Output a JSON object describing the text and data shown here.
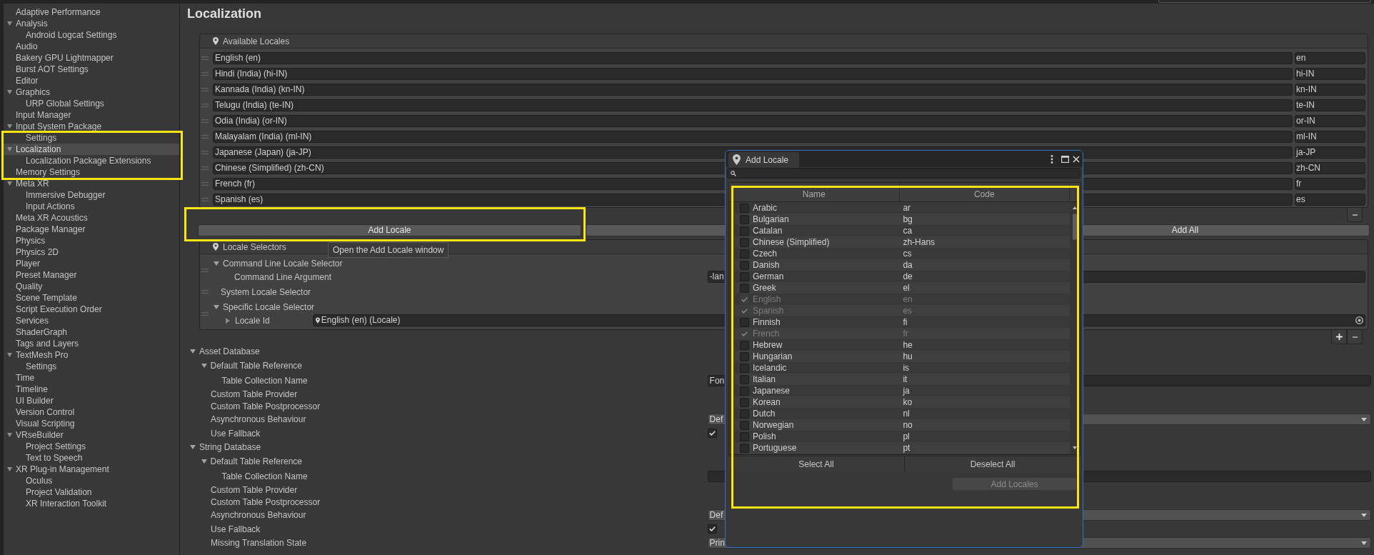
{
  "sidebar": {
    "items": [
      {
        "label": "Adaptive Performance",
        "selected": false
      },
      {
        "label": "Analysis",
        "selected": false,
        "expanded": true,
        "children": [
          {
            "label": "Android Logcat Settings",
            "selected": false
          }
        ]
      },
      {
        "label": "Audio",
        "selected": false
      },
      {
        "label": "Bakery GPU Lightmapper",
        "selected": false
      },
      {
        "label": "Burst AOT Settings",
        "selected": false
      },
      {
        "label": "Editor",
        "selected": false
      },
      {
        "label": "Graphics",
        "selected": false,
        "expanded": true,
        "children": [
          {
            "label": "URP Global Settings",
            "selected": false
          }
        ]
      },
      {
        "label": "Input Manager",
        "selected": false
      },
      {
        "label": "Input System Package",
        "selected": false,
        "expanded": true,
        "children": [
          {
            "label": "Settings",
            "selected": false
          }
        ]
      },
      {
        "label": "Localization",
        "selected": true,
        "expanded": true,
        "children": [
          {
            "label": "Localization Package Extensions",
            "selected": false
          }
        ]
      },
      {
        "label": "Memory Settings",
        "selected": false
      },
      {
        "label": "Meta XR",
        "selected": false,
        "expanded": true,
        "children": [
          {
            "label": "Immersive Debugger",
            "selected": false
          },
          {
            "label": "Input Actions",
            "selected": false
          }
        ]
      },
      {
        "label": "Meta XR Acoustics",
        "selected": false
      },
      {
        "label": "Package Manager",
        "selected": false
      },
      {
        "label": "Physics",
        "selected": false
      },
      {
        "label": "Physics 2D",
        "selected": false
      },
      {
        "label": "Player",
        "selected": false
      },
      {
        "label": "Preset Manager",
        "selected": false
      },
      {
        "label": "Quality",
        "selected": false
      },
      {
        "label": "Scene Template",
        "selected": false
      },
      {
        "label": "Script Execution Order",
        "selected": false
      },
      {
        "label": "Services",
        "selected": false
      },
      {
        "label": "ShaderGraph",
        "selected": false
      },
      {
        "label": "Tags and Layers",
        "selected": false
      },
      {
        "label": "TextMesh Pro",
        "selected": false,
        "expanded": true,
        "children": [
          {
            "label": "Settings",
            "selected": false
          }
        ]
      },
      {
        "label": "Time",
        "selected": false
      },
      {
        "label": "Timeline",
        "selected": false
      },
      {
        "label": "UI Builder",
        "selected": false
      },
      {
        "label": "Version Control",
        "selected": false
      },
      {
        "label": "Visual Scripting",
        "selected": false
      },
      {
        "label": "VRseBuilder",
        "selected": false,
        "expanded": true,
        "children": [
          {
            "label": "Project Settings",
            "selected": false
          },
          {
            "label": "Text to Speech",
            "selected": false
          }
        ]
      },
      {
        "label": "XR Plug-in Management",
        "selected": false,
        "expanded": true,
        "children": [
          {
            "label": "Oculus",
            "selected": false
          },
          {
            "label": "Project Validation",
            "selected": false
          },
          {
            "label": "XR Interaction Toolkit",
            "selected": false
          }
        ]
      }
    ]
  },
  "page": {
    "title": "Localization"
  },
  "available_locales": {
    "title": "Available Locales",
    "rows": [
      {
        "name": "English (en)",
        "code": "en"
      },
      {
        "name": "Hindi (India) (hi-IN)",
        "code": "hi-IN"
      },
      {
        "name": "Kannada (India) (kn-IN)",
        "code": "kn-IN"
      },
      {
        "name": "Telugu (India) (te-IN)",
        "code": "te-IN"
      },
      {
        "name": "Odia (India) (or-IN)",
        "code": "or-IN"
      },
      {
        "name": "Malayalam (India) (ml-IN)",
        "code": "ml-IN"
      },
      {
        "name": "Japanese (Japan) (ja-JP)",
        "code": "ja-JP"
      },
      {
        "name": "Chinese (Simplified) (zh-CN)",
        "code": "zh-CN"
      },
      {
        "name": "French (fr)",
        "code": "fr"
      },
      {
        "name": "Spanish (es)",
        "code": "es"
      }
    ]
  },
  "locale_buttons": [
    {
      "kind": "button",
      "label": "Add Locale"
    },
    {
      "kind": "blank"
    },
    {
      "kind": "button",
      "label": "Add All"
    }
  ],
  "tooltip": {
    "text": "Open the Add Locale window"
  },
  "locale_selectors": {
    "title": "Locale Selectors",
    "items": [
      {
        "kind": "foldout",
        "label": "Command Line Locale Selector",
        "expanded": true,
        "fields": [
          {
            "kind": "text",
            "label": "Command Line Argument",
            "value": "-lan"
          }
        ]
      },
      {
        "kind": "plain",
        "label": "System Locale Selector"
      },
      {
        "kind": "foldout",
        "label": "Specific Locale Selector",
        "expanded": true,
        "fields": [
          {
            "kind": "object",
            "label": "Locale Id",
            "expanded": false,
            "value": "English (en) (Locale)"
          }
        ]
      }
    ]
  },
  "databases": [
    {
      "title": "Asset Database",
      "expanded": true,
      "fields": [
        {
          "kind": "group",
          "label": "Default Table Reference",
          "expanded": true,
          "children": [
            {
              "kind": "text",
              "label": "Table Collection Name",
              "value": "Fon"
            }
          ]
        },
        {
          "kind": "empty",
          "label": "Custom Table Provider"
        },
        {
          "kind": "empty",
          "label": "Custom Table Postprocessor"
        },
        {
          "kind": "dropdown",
          "label": "Asynchronous Behaviour",
          "value": "Def"
        },
        {
          "kind": "checkbox",
          "label": "Use Fallback",
          "checked": true
        }
      ]
    },
    {
      "title": "String Database",
      "expanded": true,
      "fields": [
        {
          "kind": "group",
          "label": "Default Table Reference",
          "expanded": true,
          "children": [
            {
              "kind": "text",
              "label": "Table Collection Name"
            }
          ]
        },
        {
          "kind": "empty",
          "label": "Custom Table Provider"
        },
        {
          "kind": "empty",
          "label": "Custom Table Postprocessor"
        },
        {
          "kind": "dropdown",
          "label": "Asynchronous Behaviour",
          "value": "Def"
        },
        {
          "kind": "checkbox",
          "label": "Use Fallback",
          "checked": true
        },
        {
          "kind": "dropdown",
          "label": "Missing Translation State",
          "value": "Prin"
        }
      ]
    }
  ],
  "add_locale_window": {
    "title": "Add Locale",
    "columns": [
      "Name",
      "Code"
    ],
    "rows": [
      {
        "name": "Arabic",
        "code": "ar",
        "checked": false,
        "disabled": false
      },
      {
        "name": "Bulgarian",
        "code": "bg",
        "checked": false,
        "disabled": false
      },
      {
        "name": "Catalan",
        "code": "ca",
        "checked": false,
        "disabled": false
      },
      {
        "name": "Chinese (Simplified)",
        "code": "zh-Hans",
        "checked": false,
        "disabled": false
      },
      {
        "name": "Czech",
        "code": "cs",
        "checked": false,
        "disabled": false
      },
      {
        "name": "Danish",
        "code": "da",
        "checked": false,
        "disabled": false
      },
      {
        "name": "German",
        "code": "de",
        "checked": false,
        "disabled": false
      },
      {
        "name": "Greek",
        "code": "el",
        "checked": false,
        "disabled": false
      },
      {
        "name": "English",
        "code": "en",
        "checked": true,
        "disabled": true
      },
      {
        "name": "Spanish",
        "code": "es",
        "checked": true,
        "disabled": true
      },
      {
        "name": "Finnish",
        "code": "fi",
        "checked": false,
        "disabled": false
      },
      {
        "name": "French",
        "code": "fr",
        "checked": true,
        "disabled": true
      },
      {
        "name": "Hebrew",
        "code": "he",
        "checked": false,
        "disabled": false
      },
      {
        "name": "Hungarian",
        "code": "hu",
        "checked": false,
        "disabled": false
      },
      {
        "name": "Icelandic",
        "code": "is",
        "checked": false,
        "disabled": false
      },
      {
        "name": "Italian",
        "code": "it",
        "checked": false,
        "disabled": false
      },
      {
        "name": "Japanese",
        "code": "ja",
        "checked": false,
        "disabled": false
      },
      {
        "name": "Korean",
        "code": "ko",
        "checked": false,
        "disabled": false
      },
      {
        "name": "Dutch",
        "code": "nl",
        "checked": false,
        "disabled": false
      },
      {
        "name": "Norwegian",
        "code": "no",
        "checked": false,
        "disabled": false
      },
      {
        "name": "Polish",
        "code": "pl",
        "checked": false,
        "disabled": false
      },
      {
        "name": "Portuguese",
        "code": "pt",
        "checked": false,
        "disabled": false
      }
    ],
    "buttons": [
      "Select All",
      "Deselect All"
    ],
    "add_button": {
      "label": "Add Locales",
      "disabled": true
    }
  }
}
